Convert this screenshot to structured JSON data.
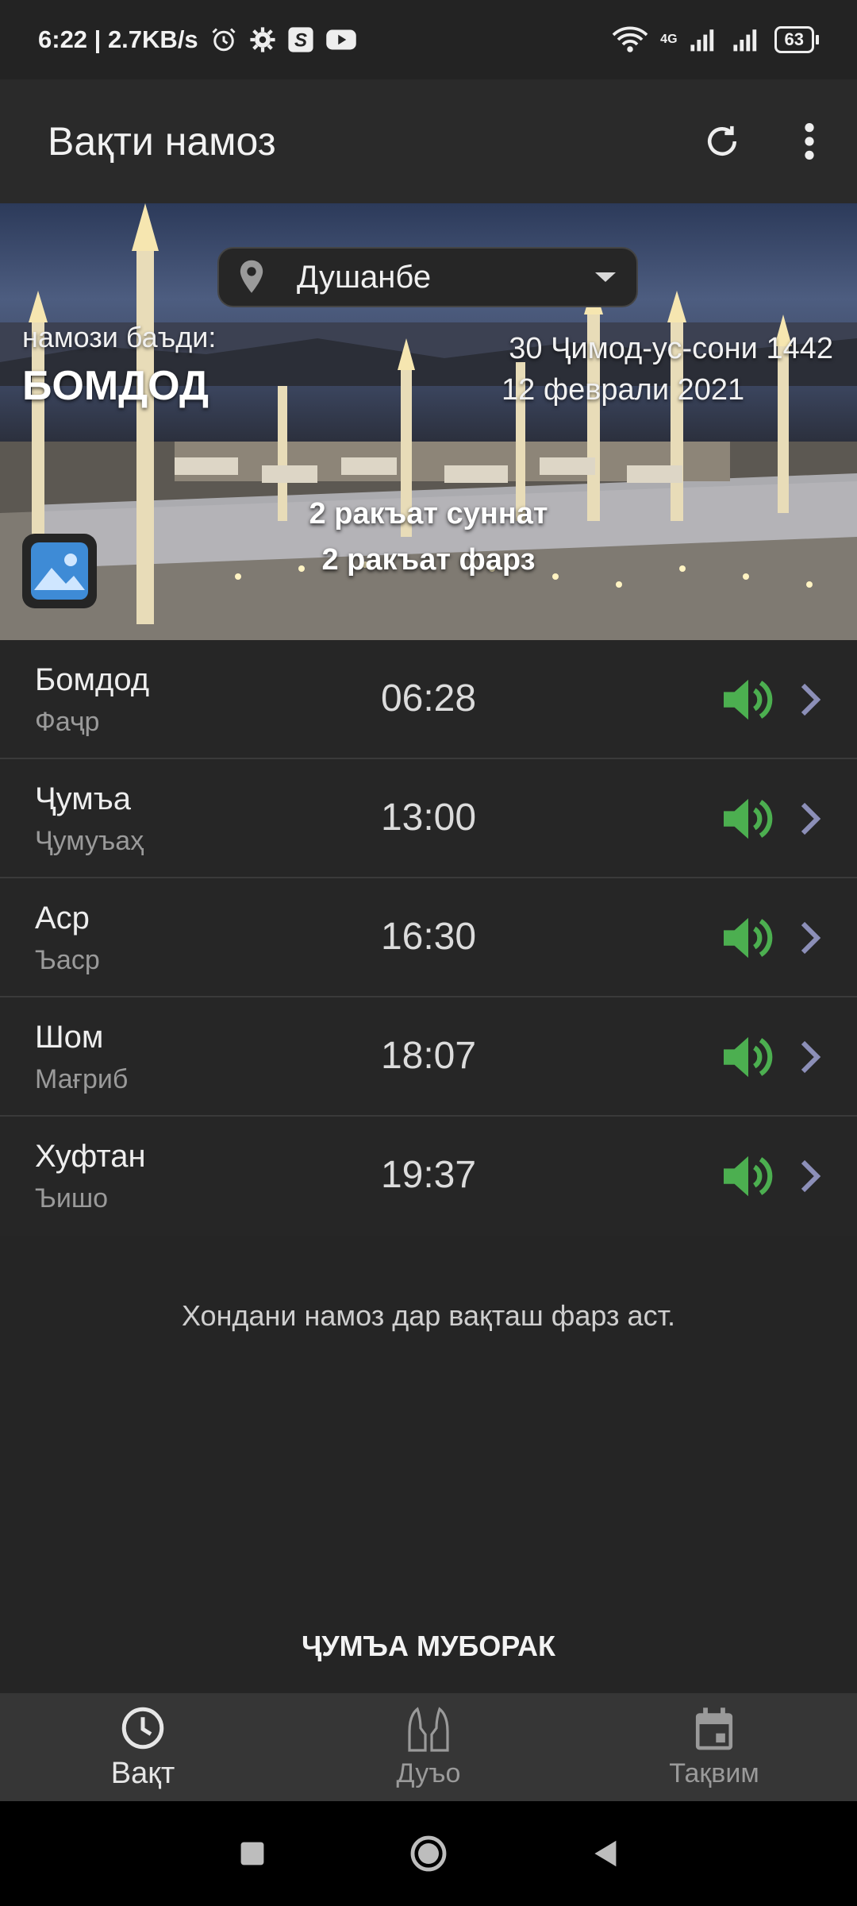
{
  "status_bar": {
    "time_speed": "6:22 | 2.7KB/s",
    "network": "4G",
    "battery": "63"
  },
  "app_bar": {
    "title": "Вақти намоз"
  },
  "hero": {
    "city": "Душанбе",
    "next_label": "намози баъди:",
    "next_prayer": "БОМДОД",
    "hijri_date": "30 Ҷимод-ус-сони 1442",
    "gregorian_date": "12 феврали 2021",
    "rakat_sunnat": "2 ракъат суннат",
    "rakat_farz": "2 ракъат фарз"
  },
  "prayers": [
    {
      "name": "Бомдод",
      "sub": "Фаҷр",
      "time": "06:28"
    },
    {
      "name": "Ҷумъа",
      "sub": "Ҷумуъаҳ",
      "time": "13:00"
    },
    {
      "name": "Аср",
      "sub": "Ъаср",
      "time": "16:30"
    },
    {
      "name": "Шом",
      "sub": "Мағриб",
      "time": "18:07"
    },
    {
      "name": "Хуфтан",
      "sub": "Ъишо",
      "time": "19:37"
    }
  ],
  "hadith": "Хондани намоз дар вақташ фарз аст.",
  "jumma": "ҶУМЪА МУБОРАК",
  "bottom_nav": {
    "items": [
      {
        "label": "Вақт",
        "icon": "clock-icon"
      },
      {
        "label": "Дуъо",
        "icon": "praying-hands-icon"
      },
      {
        "label": "Тақвим",
        "icon": "calendar-icon"
      }
    ]
  },
  "colors": {
    "sound_green": "#4caf50",
    "chevron": "#8c8fb8",
    "background": "#252525"
  }
}
